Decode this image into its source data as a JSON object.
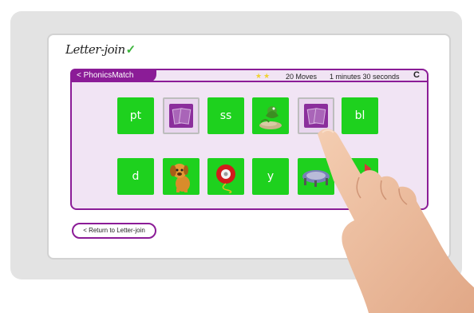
{
  "app": {
    "logo_text": "Letter-join",
    "logo_tick": "✓"
  },
  "game": {
    "back_label": "< PhonicsMatch",
    "stars": "★★",
    "moves": "20 Moves",
    "timer": "1 minutes 30 seconds",
    "restart_icon": "C"
  },
  "cards": {
    "row1": [
      {
        "type": "text",
        "text": "pt"
      },
      {
        "type": "back",
        "icon": "card-back-icon"
      },
      {
        "type": "text",
        "text": "ss"
      },
      {
        "type": "image",
        "icon": "frog-lily-pad-icon"
      },
      {
        "type": "back",
        "icon": "card-back-icon"
      },
      {
        "type": "text",
        "text": "bl"
      }
    ],
    "row2": [
      {
        "type": "text",
        "text": "d"
      },
      {
        "type": "image",
        "icon": "dog-icon"
      },
      {
        "type": "image",
        "icon": "yoyo-icon"
      },
      {
        "type": "text",
        "text": "y"
      },
      {
        "type": "image",
        "icon": "trampoline-icon"
      },
      {
        "type": "image",
        "icon": "partially-hidden-card-icon"
      }
    ]
  },
  "footer": {
    "return_label": "< Return to Letter-join"
  },
  "colors": {
    "accent": "#8b1c97",
    "card_green": "#1ed11e",
    "panel_bg": "#f1e4f4"
  }
}
